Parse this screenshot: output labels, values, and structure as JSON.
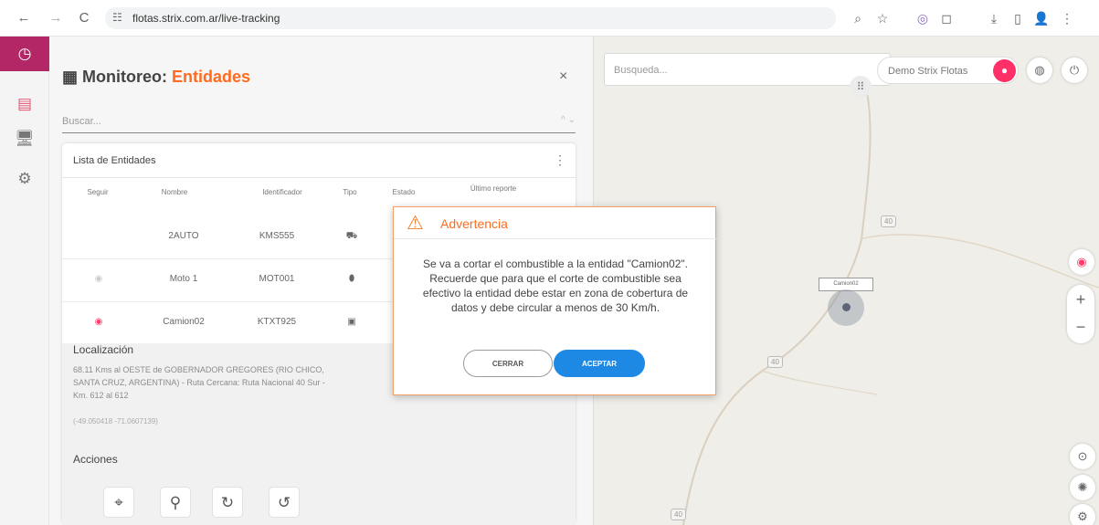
{
  "browser": {
    "url": "flotas.strix.com.ar/live-tracking",
    "controls": [
      "←",
      "→",
      "C",
      "⌕",
      "☆",
      "◎",
      "◻",
      "⤓",
      "▯",
      "👤",
      "⋮"
    ]
  },
  "colors": {
    "accent": "#ff6b1f",
    "rail_active": "#b32766",
    "button_blue": "#1e88e5",
    "eye": "#ff3b66"
  },
  "panel": {
    "title_prefix": "Monitoreo:",
    "title_highlight": "Entidades",
    "close": "×",
    "search_placeholder": "Buscar...",
    "search_arrows": "^ ⌄"
  },
  "list": {
    "title": "Lista de Entidades",
    "menu": "⋮",
    "headers": [
      "Seguir",
      "Nombre",
      "Identificador",
      "Tipo",
      "Estado",
      "Último reporte"
    ],
    "rows": [
      {
        "follow": "",
        "name": "2AUTO",
        "id": "KMS555",
        "type": "car-icon"
      },
      {
        "follow": "eye-icon",
        "name": "Moto 1",
        "id": "MOT001",
        "type": "motorcycle-icon"
      },
      {
        "follow": "eye-icon",
        "name": "Camion02",
        "id": "KTXT925",
        "type": "truck-icon"
      }
    ]
  },
  "detail": {
    "location_heading": "Localización",
    "location_text": "68.11 Kms al OESTE de GOBERNADOR GREGORES (RIO CHICO, SANTA CRUZ, ARGENTINA) - Ruta Cercana: Ruta Nacional 40 Sur - Km. 612 al 612",
    "coordinates": "(-49.050418 -71.0607139)",
    "actions_heading": "Acciones"
  },
  "map": {
    "search_placeholder": "Busqueda...",
    "user_name": "Demo Strix Flotas",
    "vehicle_label": "Camion02",
    "road_numbers": [
      "40",
      "40",
      "40"
    ]
  },
  "dialog": {
    "title": "Advertencia",
    "message": "Se va a cortar el combustible a la entidad \"Camion02\". Recuerde que para que el corte de combustible sea efectivo la entidad debe estar en zona de cobertura de datos y debe circular a menos de 30 Km/h.",
    "cancel": "CERRAR",
    "accept": "ACEPTAR"
  }
}
